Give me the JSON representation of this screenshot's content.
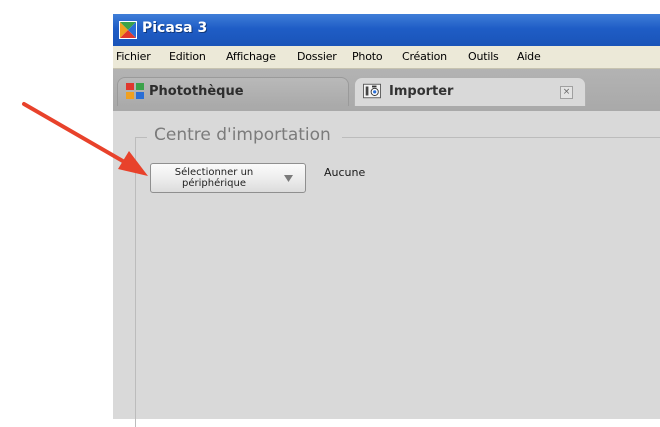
{
  "window": {
    "title": "Picasa 3",
    "title_color": "#ffffff",
    "titlebar_color": "#1f5dc6"
  },
  "menubar": {
    "items": [
      {
        "label": "Fichier"
      },
      {
        "label": "Edition"
      },
      {
        "label": "Affichage"
      },
      {
        "label": "Dossier"
      },
      {
        "label": "Photo"
      },
      {
        "label": "Création"
      },
      {
        "label": "Outils"
      },
      {
        "label": "Aide"
      }
    ]
  },
  "tabs": [
    {
      "label": "Photothèque",
      "icon": "photo-library-icon",
      "active": false
    },
    {
      "label": "Importer",
      "icon": "camera-icon",
      "active": true,
      "close_icon": "close-icon"
    }
  ],
  "import_center": {
    "section_title": "Centre d'importation",
    "device_button_label": "Sélectionner un périphérique",
    "dropdown_icon": "chevron-down-icon",
    "selected_device": "Aucune"
  },
  "annotation": {
    "arrow_color": "#e8422b",
    "arrow_icon": "red-arrow"
  }
}
